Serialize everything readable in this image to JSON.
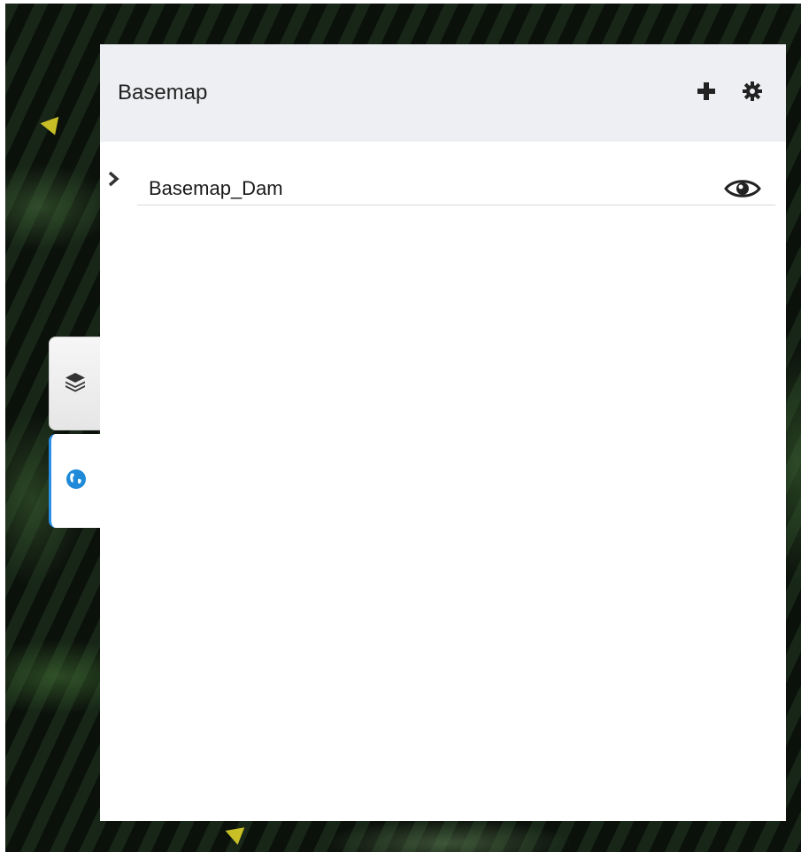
{
  "panel": {
    "title": "Basemap"
  },
  "header_actions": {
    "add_icon": "plus-icon",
    "settings_icon": "gear-icon"
  },
  "layers": [
    {
      "label": "Basemap_Dam",
      "expand_icon": "chevron-right-icon",
      "visibility_icon": "eye-icon"
    }
  ],
  "side_tabs": [
    {
      "icon": "layers-icon",
      "active": false
    },
    {
      "icon": "globe-icon",
      "active": true
    }
  ],
  "colors": {
    "header_bg": "#eeeff2",
    "active_accent": "#2b8fe6",
    "globe_blue": "#1f8ad9"
  }
}
